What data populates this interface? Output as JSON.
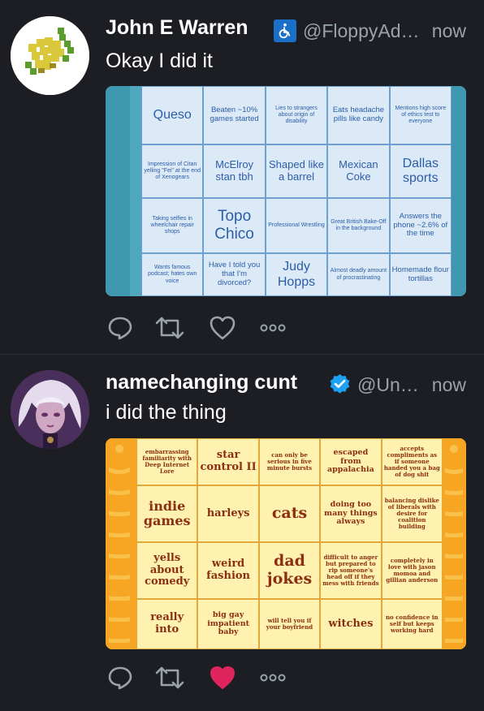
{
  "tweets": [
    {
      "name": "John E Warren",
      "handle": "@FloppyAd…",
      "time": "now",
      "text": "Okay I did it",
      "badge_icon": "wheelchair-icon",
      "liked": false,
      "bingo": [
        [
          "Queso",
          "Beaten ~10% games started",
          "Lies to strangers about origin of disability",
          "Eats headache pills like candy",
          "Mentions high score of ethics test to everyone"
        ],
        [
          "Impression of Citan yelling \"Fei\" at the end of Xenogears",
          "McElroy stan tbh",
          "Shaped like a barrel",
          "Mexican Coke",
          "Dallas sports"
        ],
        [
          "Taking selfies in wheelchair repair shops",
          "Topo Chico",
          "Professional Wrestling",
          "Great British Bake-Off in the background",
          "Answers the phone ~2.6% of the time"
        ],
        [
          "Wants famous podcast; hates own voice",
          "Have I told you that I'm divorced?",
          "Judy Hopps",
          "Almost deadly amount of procrastinating",
          "Homemade flour tortillas"
        ]
      ]
    },
    {
      "name": "namechanging cunt",
      "handle": "@Un…",
      "time": "now",
      "text": "i did the thing",
      "badge_icon": "verified-badge-icon",
      "liked": true,
      "bingo": [
        [
          "embarrassing familiarity with Deep Internet Lore",
          "star control II",
          "can only be serious in five minute bursts",
          "escaped from appalachia",
          "accepts compliments as if someone handed you a bag of dog shit"
        ],
        [
          "indie games",
          "harleys",
          "cats",
          "doing too many things always",
          "balancing dislike of liberals with desire for coalition building"
        ],
        [
          "yells about comedy",
          "weird fashion",
          "dad jokes",
          "difficult to anger but prepared to rip someone's head off if they mess with friends",
          "completely in love with jason momoa and gillian anderson"
        ],
        [
          "really into",
          "big gay impatient baby",
          "will tell you if your boyfriend",
          "witches",
          "no confidence in self but keeps working hard"
        ]
      ]
    }
  ],
  "colors": {
    "background": "#1c1e23",
    "secondary_text": "#9aa3ac",
    "like_active": "#e0245e",
    "verified": "#1da1f2"
  }
}
